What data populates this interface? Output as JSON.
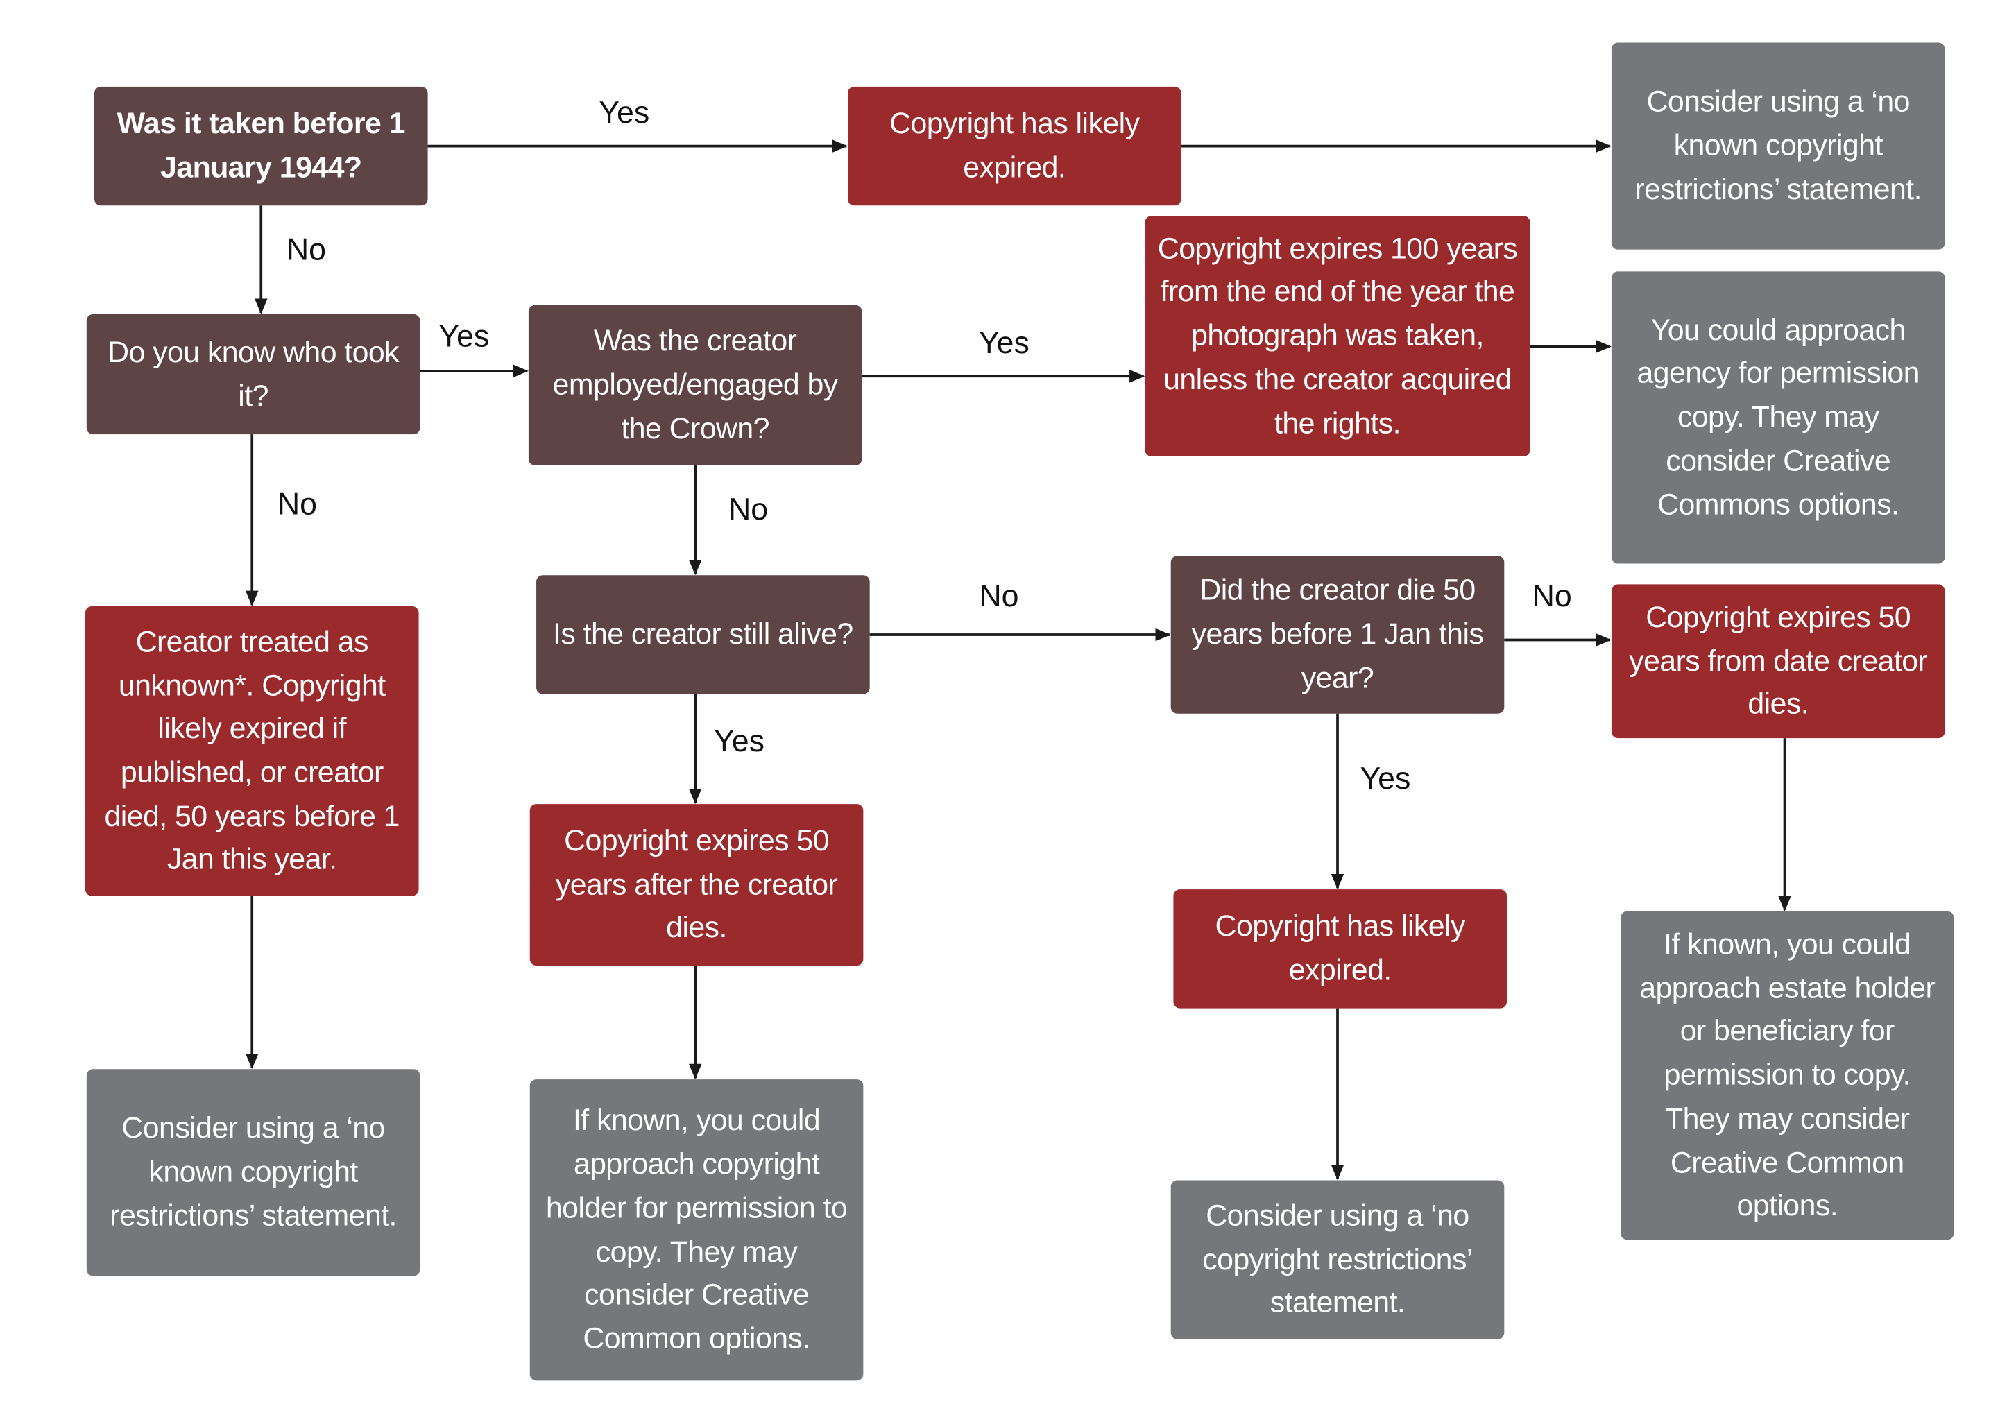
{
  "colors": {
    "question": "#5f4445",
    "outcome": "#9b2a2d",
    "advice": "#76777b"
  },
  "nodes": {
    "q_before_1944": "Was it taken before 1 January 1944?",
    "r_expired_top": "Copyright has likely expired.",
    "g_no_known_top": "Consider using a ‘no known copyright restrictions’ statement.",
    "q_know_who": "Do you know who took it?",
    "q_crown": "Was the creator employed/engaged by the Crown?",
    "r_100_years": "Copyright expires 100 years from the end of the year the photograph was taken, unless the creator acquired the rights.",
    "g_agency": "You could approach agency for permission copy. They may consider Creative Commons options.",
    "r_unknown": "Creator treated as unknown*. Copyright likely expired if published, or creator died, 50 years before 1 Jan this year.",
    "q_alive": "Is the creator still alive?",
    "q_die_50": "Did the creator die 50 years before 1 Jan this year?",
    "r_50_from_death": "Copyright expires 50 years from date creator dies.",
    "r_50_after": "Copyright expires 50 years after the creator dies.",
    "r_expired_mid": "Copyright has likely expired.",
    "g_no_known_left": "Consider using a ‘no known copyright restrictions’ statement.",
    "g_holder": "If known, you could approach copyright holder for permission to copy. They may consider Creative Common options.",
    "g_no_restrictions": "Consider using a ‘no copyright restrictions’ statement.",
    "g_estate": "If known, you could approach estate holder or beneficiary for permission to copy. They may consider Creative Common options."
  },
  "edge_labels": {
    "e1": "Yes",
    "e2": "No",
    "e3": "Yes",
    "e4": "Yes",
    "e5": "No",
    "e6": "No",
    "e7": "No",
    "e8": "No",
    "e9": "Yes",
    "e10": "Yes"
  }
}
